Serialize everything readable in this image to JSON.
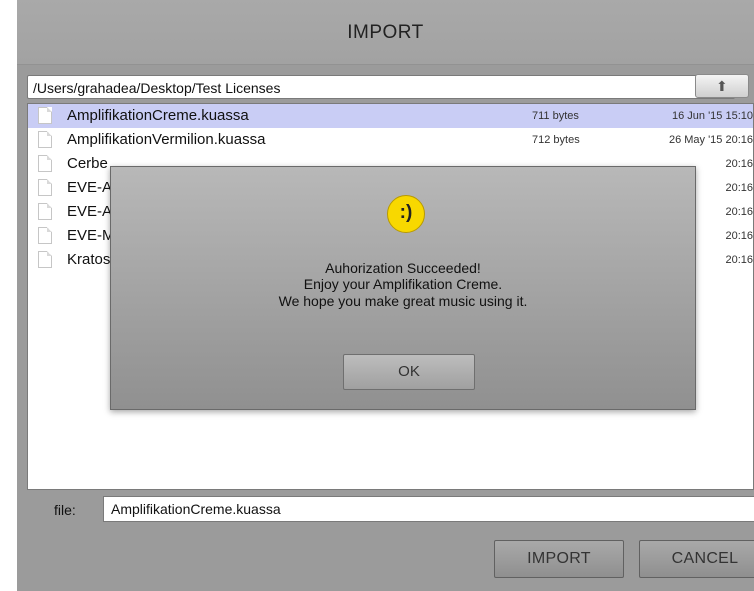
{
  "dialog": {
    "title": "IMPORT"
  },
  "path": {
    "value": "/Users/grahadea/Desktop/Test Licenses"
  },
  "files": [
    {
      "name": "AmplifikationCreme.kuassa",
      "size": "711 bytes",
      "date": "16 Jun '15 15:10",
      "selected": true
    },
    {
      "name": "AmplifikationVermilion.kuassa",
      "size": "712 bytes",
      "date": "26 May '15 20:16",
      "selected": false
    },
    {
      "name": "Cerbe",
      "size": "",
      "date": "20:16",
      "selected": false
    },
    {
      "name": "EVE-A",
      "size": "",
      "date": "20:16",
      "selected": false
    },
    {
      "name": "EVE-A",
      "size": "",
      "date": "20:16",
      "selected": false
    },
    {
      "name": "EVE-M",
      "size": "",
      "date": "20:16",
      "selected": false
    },
    {
      "name": "Kratos",
      "size": "",
      "date": "20:16",
      "selected": false
    }
  ],
  "file_field": {
    "label": "file:",
    "value": "AmplifikationCreme.kuassa"
  },
  "buttons": {
    "import": "IMPORT",
    "cancel": "CANCEL"
  },
  "alert": {
    "icon_text": ":)",
    "line1": "Auhorization Succeeded!",
    "line2": "Enjoy your Amplifikation Creme.",
    "line3": "We hope you make great music using it.",
    "ok": "OK"
  },
  "colors": {
    "selection": "#c9cdf5",
    "smiley": "#f8d800"
  }
}
